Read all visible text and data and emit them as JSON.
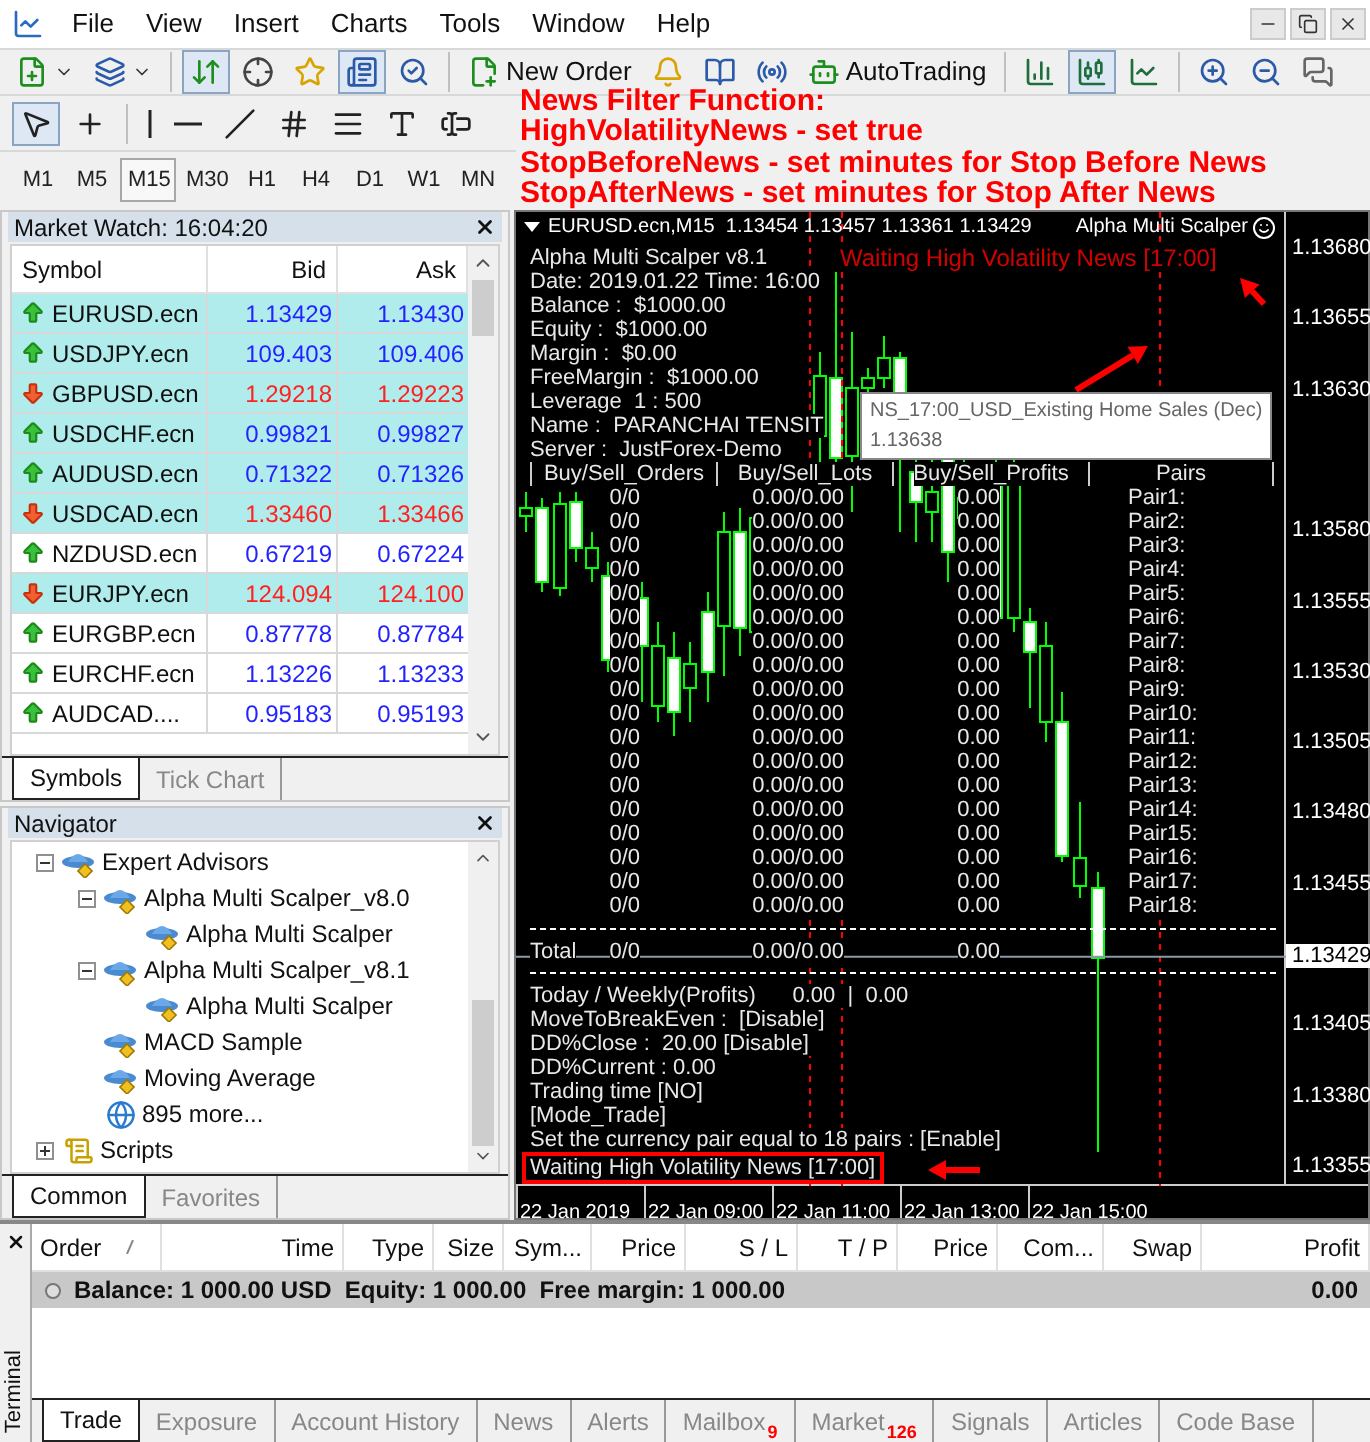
{
  "menu": {
    "items": [
      "File",
      "View",
      "Insert",
      "Charts",
      "Tools",
      "Window",
      "Help"
    ]
  },
  "toolbar": {
    "items": [
      {
        "kind": "new_chart",
        "pressed": false
      },
      {
        "kind": "profiles",
        "pressed": false
      },
      {
        "kind": "separator"
      },
      {
        "kind": "market_watch",
        "pressed": true
      },
      {
        "kind": "data_window",
        "pressed": false
      },
      {
        "kind": "navigator",
        "pressed": false
      },
      {
        "kind": "terminal",
        "pressed": true
      },
      {
        "kind": "tester",
        "pressed": false
      },
      {
        "kind": "separator"
      },
      {
        "kind": "new_order",
        "label": "New Order",
        "pressed": false
      },
      {
        "kind": "alerts",
        "pressed": false
      },
      {
        "kind": "editor",
        "pressed": false
      },
      {
        "kind": "signals",
        "pressed": false
      },
      {
        "kind": "autotrading",
        "label": "AutoTrading",
        "pressed": false
      },
      {
        "kind": "separator"
      },
      {
        "kind": "bar_chart",
        "pressed": false
      },
      {
        "kind": "candles",
        "pressed": true
      },
      {
        "kind": "line_chart",
        "pressed": false
      },
      {
        "kind": "separator"
      },
      {
        "kind": "zoom_in",
        "pressed": false
      },
      {
        "kind": "zoom_out",
        "pressed": false
      },
      {
        "kind": "chat",
        "pressed": false
      }
    ]
  },
  "drawing_tools": [
    {
      "kind": "pointer",
      "pressed": true
    },
    {
      "kind": "crosshair",
      "pressed": false
    },
    {
      "kind": "separator"
    },
    {
      "kind": "vertical_line",
      "pressed": false
    },
    {
      "kind": "horizontal_line",
      "pressed": false
    },
    {
      "kind": "trend_line",
      "pressed": false
    },
    {
      "kind": "channel",
      "pressed": false
    },
    {
      "kind": "fibo",
      "pressed": false
    },
    {
      "kind": "text",
      "pressed": false
    },
    {
      "kind": "label",
      "pressed": false
    }
  ],
  "timeframes": [
    {
      "label": "M1",
      "selected": false
    },
    {
      "label": "M5",
      "selected": false
    },
    {
      "label": "M15",
      "selected": true
    },
    {
      "label": "M30",
      "selected": false
    },
    {
      "label": "H1",
      "selected": false
    },
    {
      "label": "H4",
      "selected": false
    },
    {
      "label": "D1",
      "selected": false
    },
    {
      "label": "W1",
      "selected": false
    },
    {
      "label": "MN",
      "selected": false
    }
  ],
  "annotation": [
    "News Filter Function:",
    "HighVolatilityNews - set true",
    "StopBeforeNews - set minutes for Stop Before News",
    "StopAfterNews - set minutes for Stop After News"
  ],
  "market_watch": {
    "title": "Market Watch: 16:04:20",
    "columns": [
      "Symbol",
      "Bid",
      "Ask"
    ],
    "rows": [
      {
        "symbol": "EURUSD.ecn",
        "bid": "1.13429",
        "ask": "1.13430",
        "rising": true,
        "highlighted": true
      },
      {
        "symbol": "USDJPY.ecn",
        "bid": "109.403",
        "ask": "109.406",
        "rising": true,
        "highlighted": true
      },
      {
        "symbol": "GBPUSD.ecn",
        "bid": "1.29218",
        "ask": "1.29223",
        "rising": false,
        "highlighted": true
      },
      {
        "symbol": "USDCHF.ecn",
        "bid": "0.99821",
        "ask": "0.99827",
        "rising": true,
        "highlighted": true
      },
      {
        "symbol": "AUDUSD.ecn",
        "bid": "0.71322",
        "ask": "0.71326",
        "rising": true,
        "highlighted": true
      },
      {
        "symbol": "USDCAD.ecn",
        "bid": "1.33460",
        "ask": "1.33466",
        "rising": false,
        "highlighted": true
      },
      {
        "symbol": "NZDUSD.ecn",
        "bid": "0.67219",
        "ask": "0.67224",
        "rising": true,
        "highlighted": false
      },
      {
        "symbol": "EURJPY.ecn",
        "bid": "124.094",
        "ask": "124.100",
        "rising": false,
        "highlighted": true
      },
      {
        "symbol": "EURGBP.ecn",
        "bid": "0.87778",
        "ask": "0.87784",
        "rising": true,
        "highlighted": false
      },
      {
        "symbol": "EURCHF.ecn",
        "bid": "1.13226",
        "ask": "1.13233",
        "rising": true,
        "highlighted": false
      },
      {
        "symbol": "AUDCAD....",
        "bid": "0.95183",
        "ask": "0.95193",
        "rising": true,
        "highlighted": false
      }
    ],
    "tabs": [
      {
        "label": "Symbols",
        "selected": true
      },
      {
        "label": "Tick Chart",
        "selected": false
      }
    ]
  },
  "navigator": {
    "title": "Navigator",
    "tree": [
      {
        "label": "Expert Advisors",
        "kind": "expert",
        "expanded": true,
        "children": [
          {
            "label": "Alpha Multi Scalper_v8.0",
            "kind": "expert",
            "expanded": true,
            "children": [
              {
                "label": "Alpha Multi Scalper",
                "kind": "expert"
              }
            ]
          },
          {
            "label": "Alpha Multi Scalper_v8.1",
            "kind": "expert",
            "expanded": true,
            "children": [
              {
                "label": "Alpha Multi Scalper",
                "kind": "expert"
              }
            ]
          },
          {
            "label": "MACD Sample",
            "kind": "expert"
          },
          {
            "label": "Moving Average",
            "kind": "expert"
          },
          {
            "label": "895 more...",
            "kind": "globe"
          }
        ]
      },
      {
        "label": "Scripts",
        "kind": "script",
        "expanded": false
      }
    ],
    "tabs": [
      {
        "label": "Common",
        "selected": true
      },
      {
        "label": "Favorites",
        "selected": false
      }
    ]
  },
  "chart": {
    "header": "EURUSD.ecn,M15  1.13454 1.13457 1.13361 1.13429",
    "expert": "Alpha Multi Scalper",
    "alert": "Waiting High Volatility News [17:00]",
    "info": [
      "Alpha Multi Scalper v8.1",
      "Date: 2019.01.22 Time: 16:00",
      "Balance :  $1000.00",
      "Equity :  $1000.00",
      "Margin :  $0.00",
      "FreeMargin :  $1000.00",
      "Leverage  1 : 500",
      "Name :  PARANCHAI TENSIT",
      "Server :  JustForex-Demo"
    ],
    "table": {
      "columns": [
        "Buy/Sell_Orders",
        "Buy/Sell_Lots",
        "Buy/Sell_Profits",
        "Pairs"
      ],
      "rows": [
        {
          "orders": "0/0",
          "lots": "0.00/0.00",
          "profit": "0.00",
          "pair": "Pair1:"
        },
        {
          "orders": "0/0",
          "lots": "0.00/0.00",
          "profit": "0.00",
          "pair": "Pair2:"
        },
        {
          "orders": "0/0",
          "lots": "0.00/0.00",
          "profit": "0.00",
          "pair": "Pair3:"
        },
        {
          "orders": "0/0",
          "lots": "0.00/0.00",
          "profit": "0.00",
          "pair": "Pair4:"
        },
        {
          "orders": "0/0",
          "lots": "0.00/0.00",
          "profit": "0.00",
          "pair": "Pair5:"
        },
        {
          "orders": "0/0",
          "lots": "0.00/0.00",
          "profit": "0.00",
          "pair": "Pair6:"
        },
        {
          "orders": "0/0",
          "lots": "0.00/0.00",
          "profit": "0.00",
          "pair": "Pair7:"
        },
        {
          "orders": "0/0",
          "lots": "0.00/0.00",
          "profit": "0.00",
          "pair": "Pair8:"
        },
        {
          "orders": "0/0",
          "lots": "0.00/0.00",
          "profit": "0.00",
          "pair": "Pair9:"
        },
        {
          "orders": "0/0",
          "lots": "0.00/0.00",
          "profit": "0.00",
          "pair": "Pair10:"
        },
        {
          "orders": "0/0",
          "lots": "0.00/0.00",
          "profit": "0.00",
          "pair": "Pair11:"
        },
        {
          "orders": "0/0",
          "lots": "0.00/0.00",
          "profit": "0.00",
          "pair": "Pair12:"
        },
        {
          "orders": "0/0",
          "lots": "0.00/0.00",
          "profit": "0.00",
          "pair": "Pair13:"
        },
        {
          "orders": "0/0",
          "lots": "0.00/0.00",
          "profit": "0.00",
          "pair": "Pair14:"
        },
        {
          "orders": "0/0",
          "lots": "0.00/0.00",
          "profit": "0.00",
          "pair": "Pair15:"
        },
        {
          "orders": "0/0",
          "lots": "0.00/0.00",
          "profit": "0.00",
          "pair": "Pair16:"
        },
        {
          "orders": "0/0",
          "lots": "0.00/0.00",
          "profit": "0.00",
          "pair": "Pair17:"
        },
        {
          "orders": "0/0",
          "lots": "0.00/0.00",
          "profit": "0.00",
          "pair": "Pair18:"
        }
      ],
      "total": {
        "label": "Total",
        "orders": "0/0",
        "lots": "0.00/0.00",
        "profit": "0.00"
      }
    },
    "status": [
      {
        "text": "Today / Weekly(Profits)      0.00  |  0.00",
        "highlighted": false
      },
      {
        "text": "MoveToBreakEven :  [Disable]",
        "highlighted": false
      },
      {
        "text": "DD%Close :  20.00 [Disable]",
        "highlighted": false
      },
      {
        "text": "DD%Current : 0.00",
        "highlighted": false
      },
      {
        "text": "Trading time [NO]",
        "highlighted": false
      },
      {
        "text": "[Mode_Trade]",
        "highlighted": false
      },
      {
        "text": "Set the currency pair equal to 18 pairs : [Enable]",
        "highlighted": false
      },
      {
        "text": "Waiting High Volatility News [17:00]",
        "highlighted": true
      }
    ],
    "tooltip": {
      "title": "NS_17:00_USD_Existing Home Sales (Dec)",
      "value": "1.13638"
    },
    "price_axis": {
      "labels": [
        "1.13680",
        "1.13655",
        "1.13630",
        "1.13580",
        "1.13555",
        "1.13530",
        "1.13505",
        "1.13480",
        "1.13455",
        "1.13405",
        "1.13380",
        "1.13355"
      ],
      "current": "1.13429"
    },
    "time_axis": [
      "22 Jan 2019",
      "22 Jan 09:00",
      "22 Jan 11:00",
      "22 Jan 13:00",
      "22 Jan 15:00"
    ]
  },
  "terminal": {
    "title": "Terminal",
    "columns": [
      "Order",
      "Time",
      "Type",
      "Size",
      "Sym...",
      "Price",
      "S / L",
      "T / P",
      "Price",
      "Com...",
      "Swap",
      "Profit"
    ],
    "balance": {
      "text": "Balance: 1 000.00 USD  Equity: 1 000.00  Free margin: 1 000.00",
      "profit": "0.00"
    },
    "tabs": [
      {
        "label": "Trade",
        "selected": true
      },
      {
        "label": "Exposure",
        "selected": false
      },
      {
        "label": "Account History",
        "selected": false
      },
      {
        "label": "News",
        "selected": false
      },
      {
        "label": "Alerts",
        "selected": false
      },
      {
        "label": "Mailbox",
        "badge": "9",
        "selected": false
      },
      {
        "label": "Market",
        "badge": "126",
        "selected": false
      },
      {
        "label": "Signals",
        "selected": false
      },
      {
        "label": "Articles",
        "selected": false
      },
      {
        "label": "Code Base",
        "selected": false
      }
    ]
  }
}
